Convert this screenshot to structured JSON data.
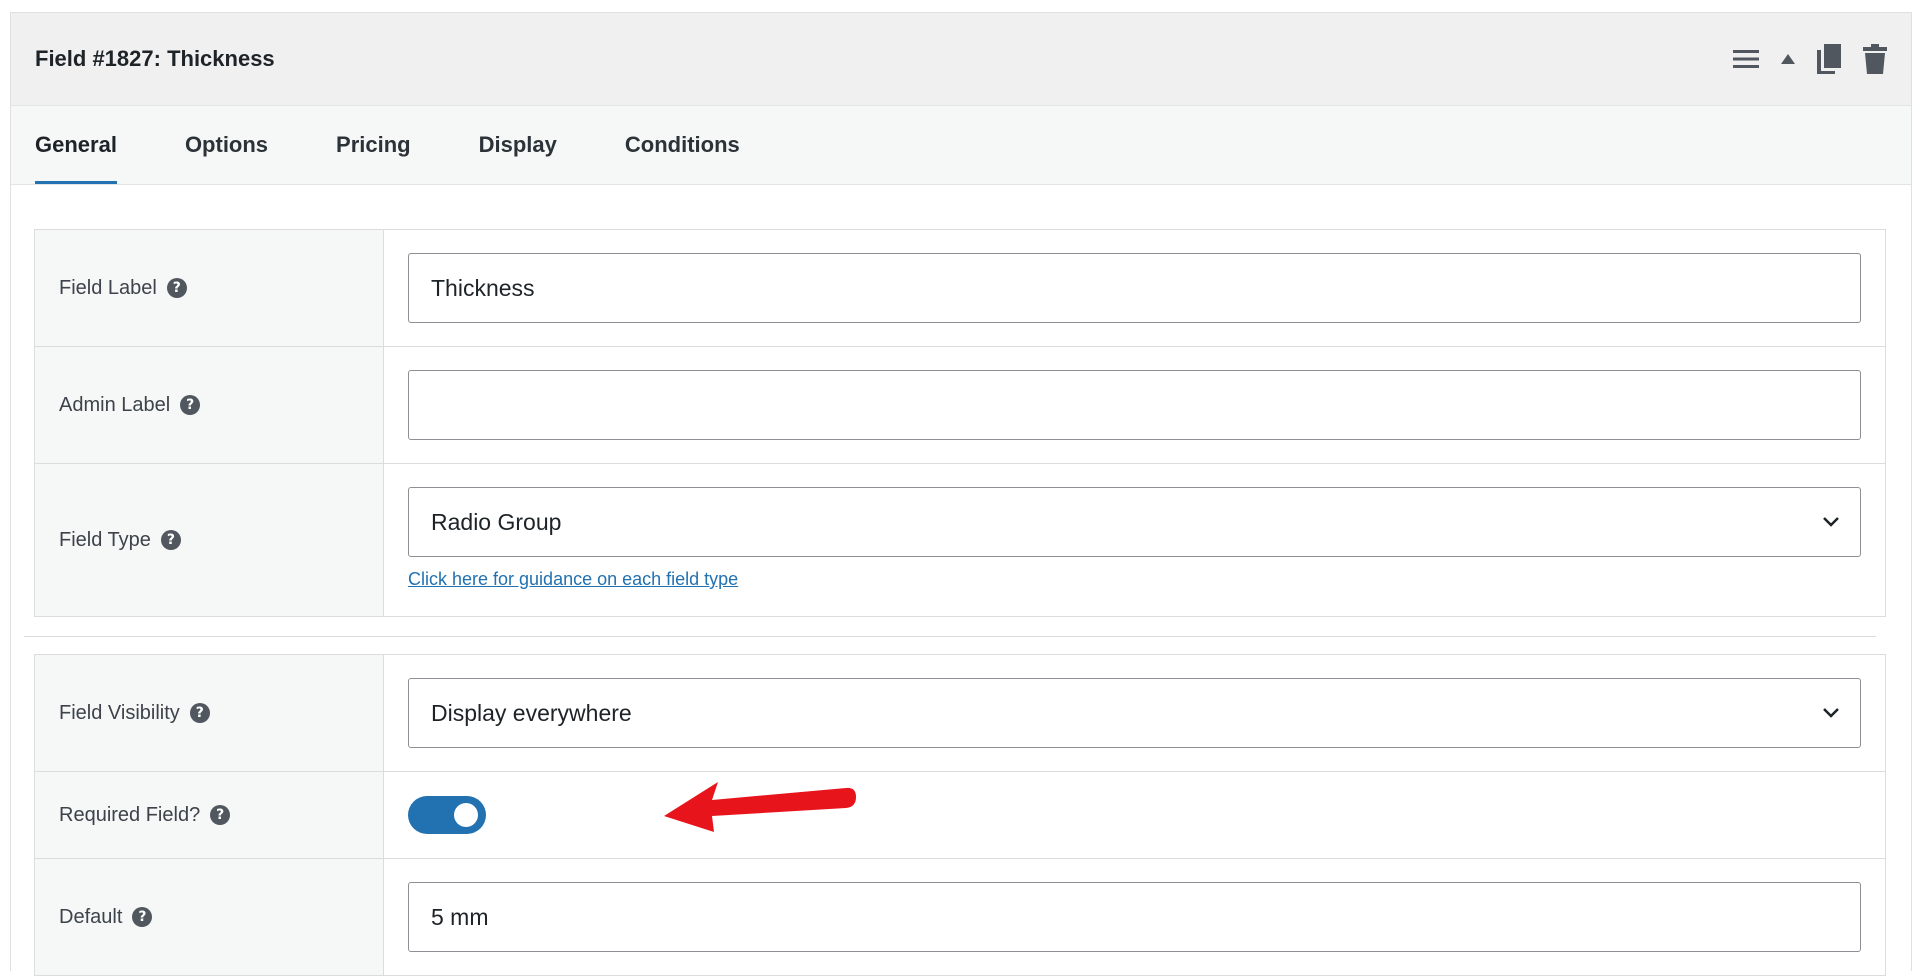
{
  "header": {
    "title": "Field #1827: Thickness",
    "actions": [
      "menu-icon",
      "collapse-arrow-icon",
      "duplicate-icon",
      "trash-icon"
    ]
  },
  "tabs": [
    {
      "label": "General",
      "active": true
    },
    {
      "label": "Options",
      "active": false
    },
    {
      "label": "Pricing",
      "active": false
    },
    {
      "label": "Display",
      "active": false
    },
    {
      "label": "Conditions",
      "active": false
    }
  ],
  "fields": {
    "field_label": {
      "label": "Field Label",
      "value": "Thickness"
    },
    "admin_label": {
      "label": "Admin Label",
      "value": "",
      "placeholder": ""
    },
    "field_type": {
      "label": "Field Type",
      "value": "Radio Group",
      "guidance_link": "Click here for guidance on each field type"
    },
    "field_visibility": {
      "label": "Field Visibility",
      "value": "Display everywhere"
    },
    "required_field": {
      "label": "Required Field?",
      "enabled": true
    },
    "default": {
      "label": "Default",
      "value": "5 mm"
    }
  },
  "colors": {
    "accent": "#2271b1",
    "header_bg": "#f0f0f1",
    "annotation_arrow": "#e8141b"
  }
}
